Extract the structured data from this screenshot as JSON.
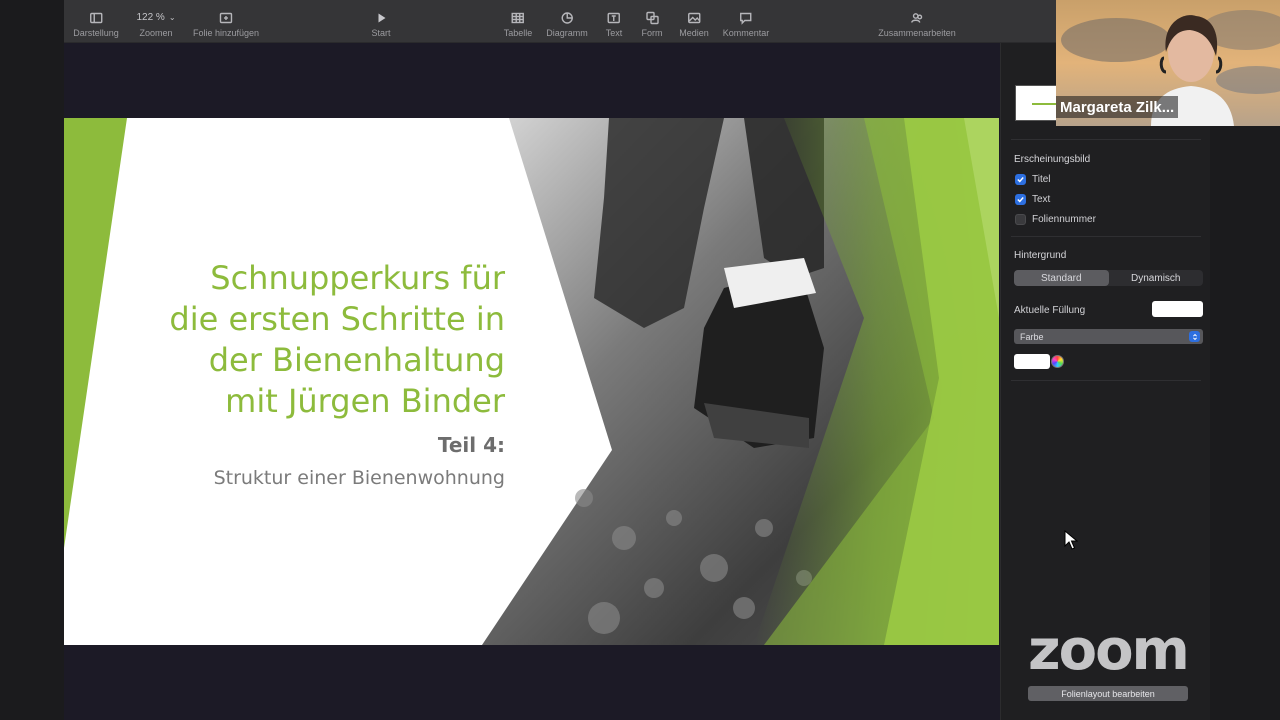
{
  "toolbar": {
    "items": [
      {
        "label": "Darstellung",
        "icon": "sidebar-icon"
      },
      {
        "label": "Zoomen",
        "value": "122 %",
        "icon": "chevron-down-icon"
      },
      {
        "label": "Folie hinzufügen",
        "icon": "add-slide-icon"
      },
      {
        "label": "Start",
        "icon": "play-icon"
      },
      {
        "label": "Tabelle",
        "icon": "table-icon"
      },
      {
        "label": "Diagramm",
        "icon": "chart-icon"
      },
      {
        "label": "Text",
        "icon": "text-icon"
      },
      {
        "label": "Form",
        "icon": "shape-icon"
      },
      {
        "label": "Medien",
        "icon": "media-icon"
      },
      {
        "label": "Kommentar",
        "icon": "comment-icon"
      },
      {
        "label": "Zusammenarbeiten",
        "icon": "collaborate-icon"
      }
    ]
  },
  "slide": {
    "title_lines": [
      "Schnupperkurs für",
      "die ersten Schritte in",
      "der Bienenhaltung",
      "mit Jürgen Binder"
    ],
    "part": "Teil 4:",
    "subtitle": "Struktur einer Bienenwohnung",
    "accent_color": "#8dbb3c"
  },
  "inspector": {
    "appearance": {
      "title": "Erscheinungsbild",
      "options": [
        {
          "label": "Titel",
          "checked": true
        },
        {
          "label": "Text",
          "checked": true
        },
        {
          "label": "Foliennummer",
          "checked": false
        }
      ]
    },
    "background": {
      "title": "Hintergrund",
      "segments": [
        "Standard",
        "Dynamisch"
      ],
      "active_segment": "Standard",
      "fill_label": "Aktuelle Füllung",
      "fill_type": "Farbe"
    },
    "edit_layout_button": "Folienlayout bearbeiten"
  },
  "zoom": {
    "logo_text": "zoom",
    "participant_name": "Margareta Zilk..."
  }
}
